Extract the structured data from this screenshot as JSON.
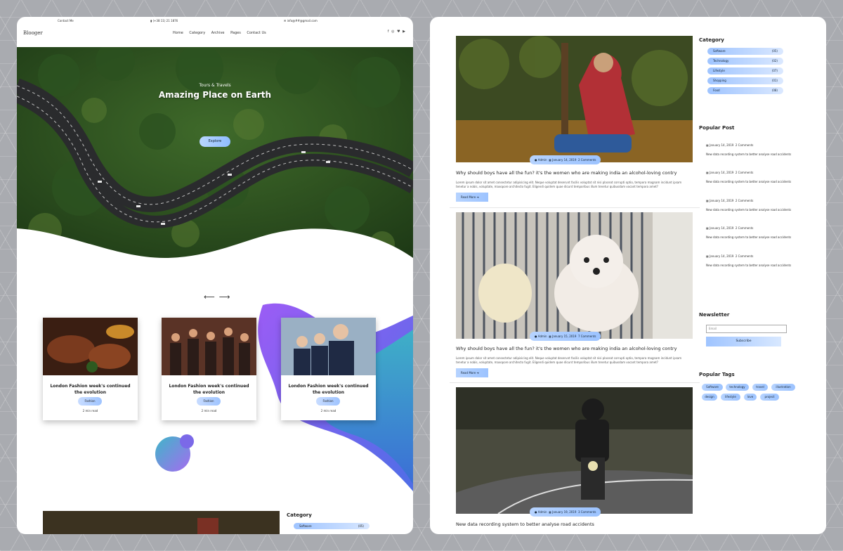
{
  "left": {
    "topbar": {
      "contact": "Contact Me",
      "phone": "(+38 11) 21 1876",
      "email": "info@##@gmail.com"
    },
    "logo": "Blooger",
    "menu": [
      "Home",
      "Category",
      "Archive",
      "Pages",
      "Contact Us"
    ],
    "social_icons": [
      "facebook-icon",
      "instagram-icon",
      "twitter-icon",
      "youtube-icon"
    ],
    "hero": {
      "subtitle": "Tours & Travels",
      "title": "Amazing Place on Earth",
      "button": "Explore"
    },
    "cards": [
      {
        "title": "London Fashion week's continued the evolution",
        "tag": "Fashion",
        "time": "2 min read"
      },
      {
        "title": "London Fashion week's continued the evolution",
        "tag": "Fashion",
        "time": "2 min read"
      },
      {
        "title": "London Fashion week's continued the evolution",
        "tag": "Fashion",
        "time": "2 min read"
      }
    ],
    "mini_category": {
      "title": "Category",
      "first_name": "Software",
      "first_count": "(05)"
    }
  },
  "right": {
    "posts": [
      {
        "author": "Admin",
        "date": "January 14, 2019",
        "comments": "2 Comments",
        "title": "Why should boys have all the fun? it's the women who are making india an alcohol-loving contry",
        "excerpt": "Lorem ipsum dolor sit amet consectetur adipisicing elit. Neque voluptat deserunt facilis voluptat sit nisi placeat corrupti optio, tempora magnam incidunt ipsam tenetur a nobis, voluptate, maxopore architecto fugit. Eligendi quidem quae dicunt temporibus illum tenetur quibusdam vocant tempora amet?",
        "button": "Read More"
      },
      {
        "author": "Admin",
        "date": "January 15, 2019",
        "comments": "7 Comments",
        "title": "Why should boys have all the fun? it's the women who are making india an alcohol-loving contry",
        "excerpt": "Lorem ipsum dolor sit amet consectetur adipisicing elit. Neque voluptat deserunt facilis voluptat sit nisi placeat corrupti optio, tempora magnam incidunt ipsam tenetur a nobis, voluptate, maxopore architecto fugit. Eligendi quidem quae dicunt temporibus illum tenetur quibusdam vocant tempora amet?",
        "button": "Read More"
      },
      {
        "author": "Admin",
        "date": "January 19, 2019",
        "comments": "3 Comments",
        "title": "New data recording system to better analyse road accidents"
      }
    ],
    "category": {
      "title": "Category",
      "items": [
        {
          "name": "Software",
          "count": "(05)"
        },
        {
          "name": "Technology",
          "count": "(02)"
        },
        {
          "name": "Lifestyle",
          "count": "(07)"
        },
        {
          "name": "Shopping",
          "count": "(01)"
        },
        {
          "name": "Food",
          "count": "(08)"
        }
      ]
    },
    "popular": {
      "title": "Popular Post",
      "items": [
        {
          "date": "January 14, 2019",
          "comments": "2 Comments",
          "text": "New data recording system to better analyse road accidents"
        },
        {
          "date": "January 14, 2019",
          "comments": "2 Comments",
          "text": "New data recording system to better analyse road accidents"
        },
        {
          "date": "January 14, 2019",
          "comments": "2 Comments",
          "text": "New data recording system to better analyse road accidents"
        },
        {
          "date": "January 14, 2019",
          "comments": "2 Comments",
          "text": "New data recording system to better analyse road accidents"
        },
        {
          "date": "January 14, 2019",
          "comments": "2 Comments",
          "text": "New data recording system to better analyse road accidents"
        }
      ]
    },
    "newsletter": {
      "title": "Newsletter",
      "placeholder": "Email",
      "button": "Subscribe"
    },
    "tags": {
      "title": "Popular Tags",
      "items": [
        "Software",
        "technology",
        "travel",
        "illustration",
        "design",
        "lifestyle",
        "love",
        "project"
      ]
    }
  }
}
